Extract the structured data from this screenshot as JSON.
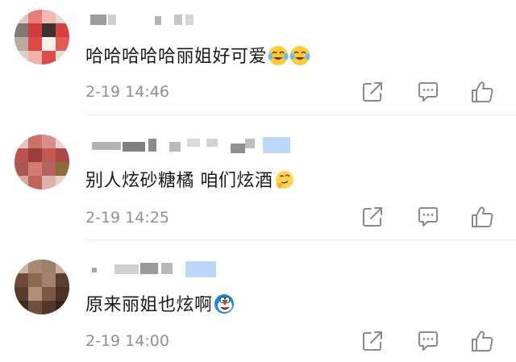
{
  "colors": {
    "text": "#1a1a1a",
    "meta": "#8f8f8f",
    "icon": "#8a8a8a",
    "divider": "#ececec",
    "vip_badge": "#bcd7f7"
  },
  "comments": [
    {
      "text": "哈哈哈哈哈丽姐好可爱",
      "emojis": [
        "crying-laughing-emoji",
        "crying-laughing-emoji"
      ],
      "time": "2-19 14:46"
    },
    {
      "text": "别人炫砂糖橘 咱们炫酒",
      "emojis": [
        "thinking-emoji"
      ],
      "time": "2-19 14:25"
    },
    {
      "text": "原来丽姐也炫啊",
      "emojis": [
        "doraemon-emoji"
      ],
      "time": "2-19 14:00"
    }
  ],
  "actions": {
    "share_icon": "share-icon",
    "reply_icon": "comment-icon",
    "like_icon": "thumbs-up-icon"
  }
}
